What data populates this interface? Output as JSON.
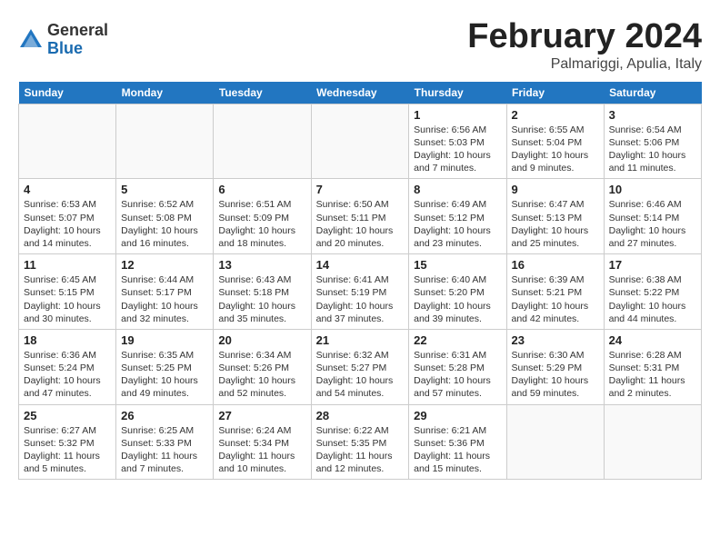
{
  "header": {
    "logo_general": "General",
    "logo_blue": "Blue",
    "month_title": "February 2024",
    "location": "Palmariggi, Apulia, Italy"
  },
  "weekdays": [
    "Sunday",
    "Monday",
    "Tuesday",
    "Wednesday",
    "Thursday",
    "Friday",
    "Saturday"
  ],
  "weeks": [
    [
      {
        "day": "",
        "info": ""
      },
      {
        "day": "",
        "info": ""
      },
      {
        "day": "",
        "info": ""
      },
      {
        "day": "",
        "info": ""
      },
      {
        "day": "1",
        "info": "Sunrise: 6:56 AM\nSunset: 5:03 PM\nDaylight: 10 hours\nand 7 minutes."
      },
      {
        "day": "2",
        "info": "Sunrise: 6:55 AM\nSunset: 5:04 PM\nDaylight: 10 hours\nand 9 minutes."
      },
      {
        "day": "3",
        "info": "Sunrise: 6:54 AM\nSunset: 5:06 PM\nDaylight: 10 hours\nand 11 minutes."
      }
    ],
    [
      {
        "day": "4",
        "info": "Sunrise: 6:53 AM\nSunset: 5:07 PM\nDaylight: 10 hours\nand 14 minutes."
      },
      {
        "day": "5",
        "info": "Sunrise: 6:52 AM\nSunset: 5:08 PM\nDaylight: 10 hours\nand 16 minutes."
      },
      {
        "day": "6",
        "info": "Sunrise: 6:51 AM\nSunset: 5:09 PM\nDaylight: 10 hours\nand 18 minutes."
      },
      {
        "day": "7",
        "info": "Sunrise: 6:50 AM\nSunset: 5:11 PM\nDaylight: 10 hours\nand 20 minutes."
      },
      {
        "day": "8",
        "info": "Sunrise: 6:49 AM\nSunset: 5:12 PM\nDaylight: 10 hours\nand 23 minutes."
      },
      {
        "day": "9",
        "info": "Sunrise: 6:47 AM\nSunset: 5:13 PM\nDaylight: 10 hours\nand 25 minutes."
      },
      {
        "day": "10",
        "info": "Sunrise: 6:46 AM\nSunset: 5:14 PM\nDaylight: 10 hours\nand 27 minutes."
      }
    ],
    [
      {
        "day": "11",
        "info": "Sunrise: 6:45 AM\nSunset: 5:15 PM\nDaylight: 10 hours\nand 30 minutes."
      },
      {
        "day": "12",
        "info": "Sunrise: 6:44 AM\nSunset: 5:17 PM\nDaylight: 10 hours\nand 32 minutes."
      },
      {
        "day": "13",
        "info": "Sunrise: 6:43 AM\nSunset: 5:18 PM\nDaylight: 10 hours\nand 35 minutes."
      },
      {
        "day": "14",
        "info": "Sunrise: 6:41 AM\nSunset: 5:19 PM\nDaylight: 10 hours\nand 37 minutes."
      },
      {
        "day": "15",
        "info": "Sunrise: 6:40 AM\nSunset: 5:20 PM\nDaylight: 10 hours\nand 39 minutes."
      },
      {
        "day": "16",
        "info": "Sunrise: 6:39 AM\nSunset: 5:21 PM\nDaylight: 10 hours\nand 42 minutes."
      },
      {
        "day": "17",
        "info": "Sunrise: 6:38 AM\nSunset: 5:22 PM\nDaylight: 10 hours\nand 44 minutes."
      }
    ],
    [
      {
        "day": "18",
        "info": "Sunrise: 6:36 AM\nSunset: 5:24 PM\nDaylight: 10 hours\nand 47 minutes."
      },
      {
        "day": "19",
        "info": "Sunrise: 6:35 AM\nSunset: 5:25 PM\nDaylight: 10 hours\nand 49 minutes."
      },
      {
        "day": "20",
        "info": "Sunrise: 6:34 AM\nSunset: 5:26 PM\nDaylight: 10 hours\nand 52 minutes."
      },
      {
        "day": "21",
        "info": "Sunrise: 6:32 AM\nSunset: 5:27 PM\nDaylight: 10 hours\nand 54 minutes."
      },
      {
        "day": "22",
        "info": "Sunrise: 6:31 AM\nSunset: 5:28 PM\nDaylight: 10 hours\nand 57 minutes."
      },
      {
        "day": "23",
        "info": "Sunrise: 6:30 AM\nSunset: 5:29 PM\nDaylight: 10 hours\nand 59 minutes."
      },
      {
        "day": "24",
        "info": "Sunrise: 6:28 AM\nSunset: 5:31 PM\nDaylight: 11 hours\nand 2 minutes."
      }
    ],
    [
      {
        "day": "25",
        "info": "Sunrise: 6:27 AM\nSunset: 5:32 PM\nDaylight: 11 hours\nand 5 minutes."
      },
      {
        "day": "26",
        "info": "Sunrise: 6:25 AM\nSunset: 5:33 PM\nDaylight: 11 hours\nand 7 minutes."
      },
      {
        "day": "27",
        "info": "Sunrise: 6:24 AM\nSunset: 5:34 PM\nDaylight: 11 hours\nand 10 minutes."
      },
      {
        "day": "28",
        "info": "Sunrise: 6:22 AM\nSunset: 5:35 PM\nDaylight: 11 hours\nand 12 minutes."
      },
      {
        "day": "29",
        "info": "Sunrise: 6:21 AM\nSunset: 5:36 PM\nDaylight: 11 hours\nand 15 minutes."
      },
      {
        "day": "",
        "info": ""
      },
      {
        "day": "",
        "info": ""
      }
    ]
  ]
}
